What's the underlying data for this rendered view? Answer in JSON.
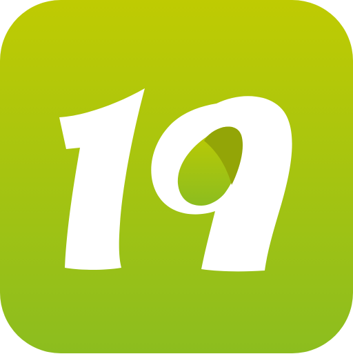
{
  "icon": {
    "name": "19 app icon",
    "label": "19",
    "colors": {
      "gradient_top": "#bfcb02",
      "gradient_bottom": "#8cbd1f",
      "glyph": "#ffffff",
      "counter_shade_light": "#a7b70a",
      "counter_shade_dark": "#93a507"
    }
  }
}
